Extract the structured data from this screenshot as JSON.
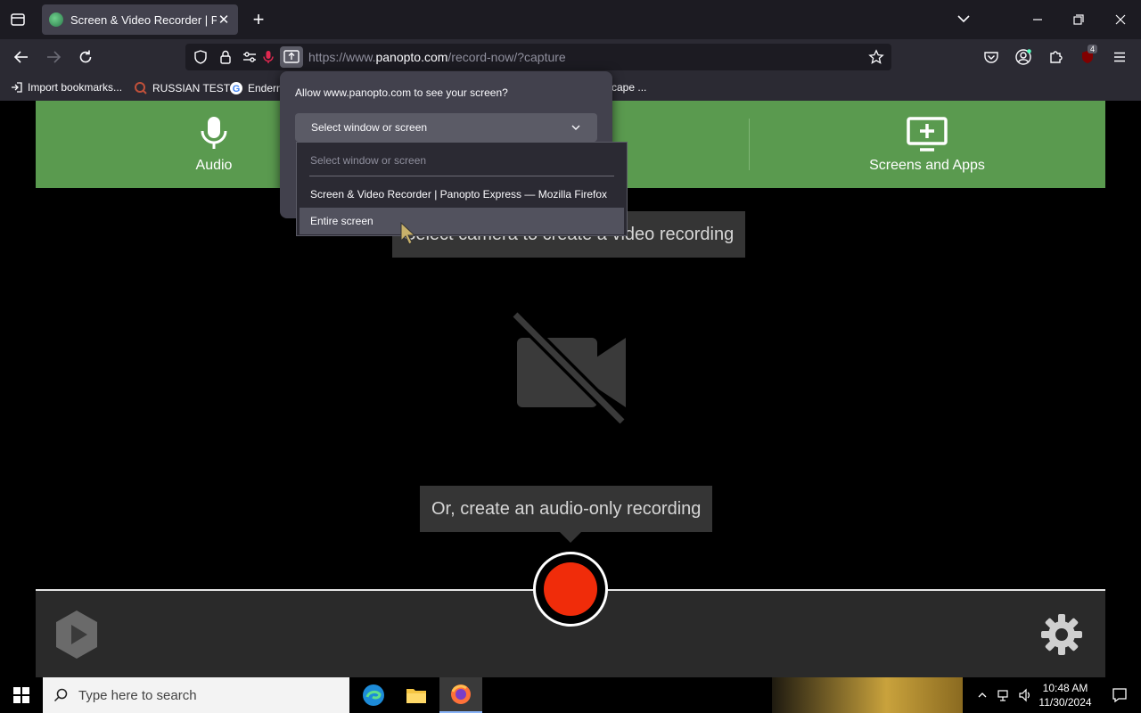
{
  "browser": {
    "tab_title": "Screen & Video Recorder | Panopto Express",
    "tab_close": "✕",
    "new_tab": "+",
    "url_prefix": "https://www.",
    "url_domain": "panopto.com",
    "url_path": "/record-now/?capture",
    "extension_badge": "4"
  },
  "bookmarks": [
    {
      "label": "Import bookmarks..."
    },
    {
      "label": "RUSSIAN TEST"
    },
    {
      "label": "Endern"
    },
    {
      "label": "cape ..."
    }
  ],
  "permission": {
    "question": "Allow www.panopto.com to see your screen?",
    "select_value": "Select window or screen",
    "options": [
      {
        "label": "Select window or screen"
      },
      {
        "label": "Screen & Video Recorder | Panopto Express — Mozilla Firefox"
      },
      {
        "label": "Entire screen"
      }
    ]
  },
  "recorder": {
    "audio_label": "Audio",
    "screens_label": "Screens and Apps",
    "camera_hint": "Select camera to create a video recording",
    "audio_hint": "Or, create an audio-only recording"
  },
  "taskbar": {
    "search_placeholder": "Type here to search",
    "time": "10:48 AM",
    "date": "11/30/2024"
  },
  "colors": {
    "band_green": "#5a9a4f",
    "record_red": "#f02c0a"
  }
}
